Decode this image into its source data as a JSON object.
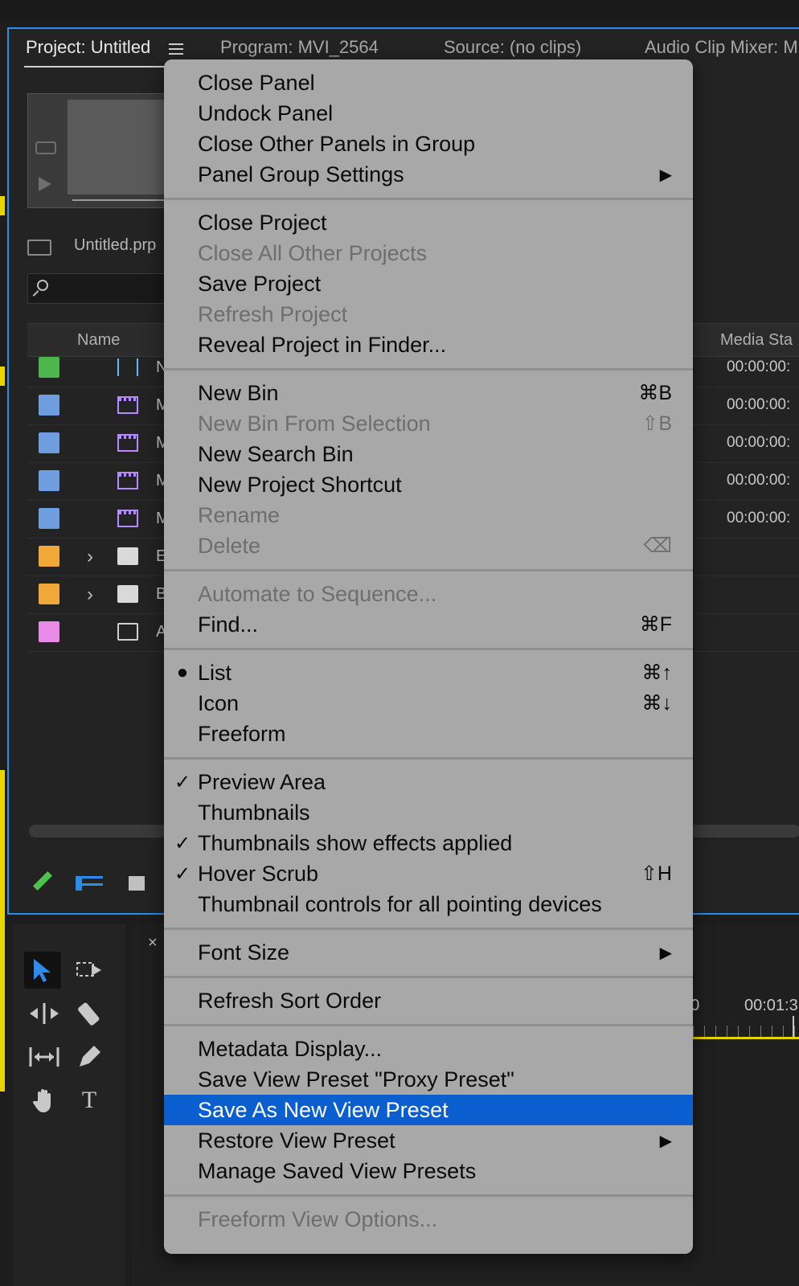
{
  "panel_tabs": {
    "project": "Project: Untitled",
    "program": "Program: MVI_2564",
    "source": "Source: (no clips)",
    "audio_mixer": "Audio Clip Mixer: M"
  },
  "project_panel": {
    "bin_name": "Untitled.prp",
    "columns": {
      "name": "Name",
      "media_start": "Media Sta"
    },
    "rows": [
      {
        "color": "#4cb64c",
        "icon": "sequence-icon",
        "initial": "N",
        "media_start": "00:00:00:"
      },
      {
        "color": "#6f9ee0",
        "icon": "clip-icon",
        "initial": "M",
        "media_start": "00:00:00:"
      },
      {
        "color": "#6f9ee0",
        "icon": "clip-icon",
        "initial": "M",
        "media_start": "00:00:00:"
      },
      {
        "color": "#6f9ee0",
        "icon": "clip-icon",
        "initial": "M",
        "media_start": "00:00:00:"
      },
      {
        "color": "#6f9ee0",
        "icon": "clip-icon",
        "initial": "M",
        "media_start": "00:00:00:"
      },
      {
        "color": "#f0a838",
        "icon": "folder-icon",
        "initial": "E",
        "media_start": ""
      },
      {
        "color": "#f0a838",
        "icon": "folder-icon",
        "initial": "B",
        "media_start": ""
      },
      {
        "color": "#e88ae6",
        "icon": "file-icon",
        "initial": "A",
        "media_start": ""
      }
    ]
  },
  "timeline": {
    "close": "×",
    "time_1": "00",
    "time_2": "00:01:3"
  },
  "tools": {
    "type_tool": "T"
  },
  "menu": {
    "groups": [
      [
        {
          "label": "Close Panel"
        },
        {
          "label": "Undock Panel"
        },
        {
          "label": "Close Other Panels in Group"
        },
        {
          "label": "Panel Group Settings",
          "submenu": true
        }
      ],
      [
        {
          "label": "Close Project"
        },
        {
          "label": "Close All Other Projects",
          "disabled": true
        },
        {
          "label": "Save Project"
        },
        {
          "label": "Refresh Project",
          "disabled": true
        },
        {
          "label": "Reveal Project in Finder..."
        }
      ],
      [
        {
          "label": "New Bin",
          "shortcut": "⌘B"
        },
        {
          "label": "New Bin From Selection",
          "shortcut": "⇧B",
          "disabled": true
        },
        {
          "label": "New Search Bin"
        },
        {
          "label": "New Project Shortcut"
        },
        {
          "label": "Rename",
          "disabled": true
        },
        {
          "label": "Delete",
          "shortcut": "⌫",
          "disabled": true
        }
      ],
      [
        {
          "label": "Automate to Sequence...",
          "disabled": true
        },
        {
          "label": "Find...",
          "shortcut": "⌘F"
        }
      ],
      [
        {
          "label": "List",
          "mark": "●",
          "shortcut": "⌘↑"
        },
        {
          "label": "Icon",
          "shortcut": "⌘↓"
        },
        {
          "label": "Freeform"
        }
      ],
      [
        {
          "label": "Preview Area",
          "mark": "✓"
        },
        {
          "label": "Thumbnails"
        },
        {
          "label": "Thumbnails show effects applied",
          "mark": "✓"
        },
        {
          "label": "Hover Scrub",
          "mark": "✓",
          "shortcut": "⇧H"
        },
        {
          "label": "Thumbnail controls for all pointing devices"
        }
      ],
      [
        {
          "label": "Font Size",
          "submenu": true
        }
      ],
      [
        {
          "label": "Refresh Sort Order"
        }
      ],
      [
        {
          "label": "Metadata Display..."
        },
        {
          "label": "Save View Preset \"Proxy Preset\""
        },
        {
          "label": "Save As New View Preset",
          "selected": true
        },
        {
          "label": "Restore View Preset",
          "submenu": true
        },
        {
          "label": "Manage Saved View Presets"
        }
      ],
      [
        {
          "label": "Freeform View Options...",
          "disabled": true
        }
      ]
    ],
    "submenu_arrow": "▶"
  },
  "colors": {
    "accent": "#2d8ceb",
    "menu_bg": "#a8a8a8",
    "menu_highlight": "#0a5ecf"
  }
}
